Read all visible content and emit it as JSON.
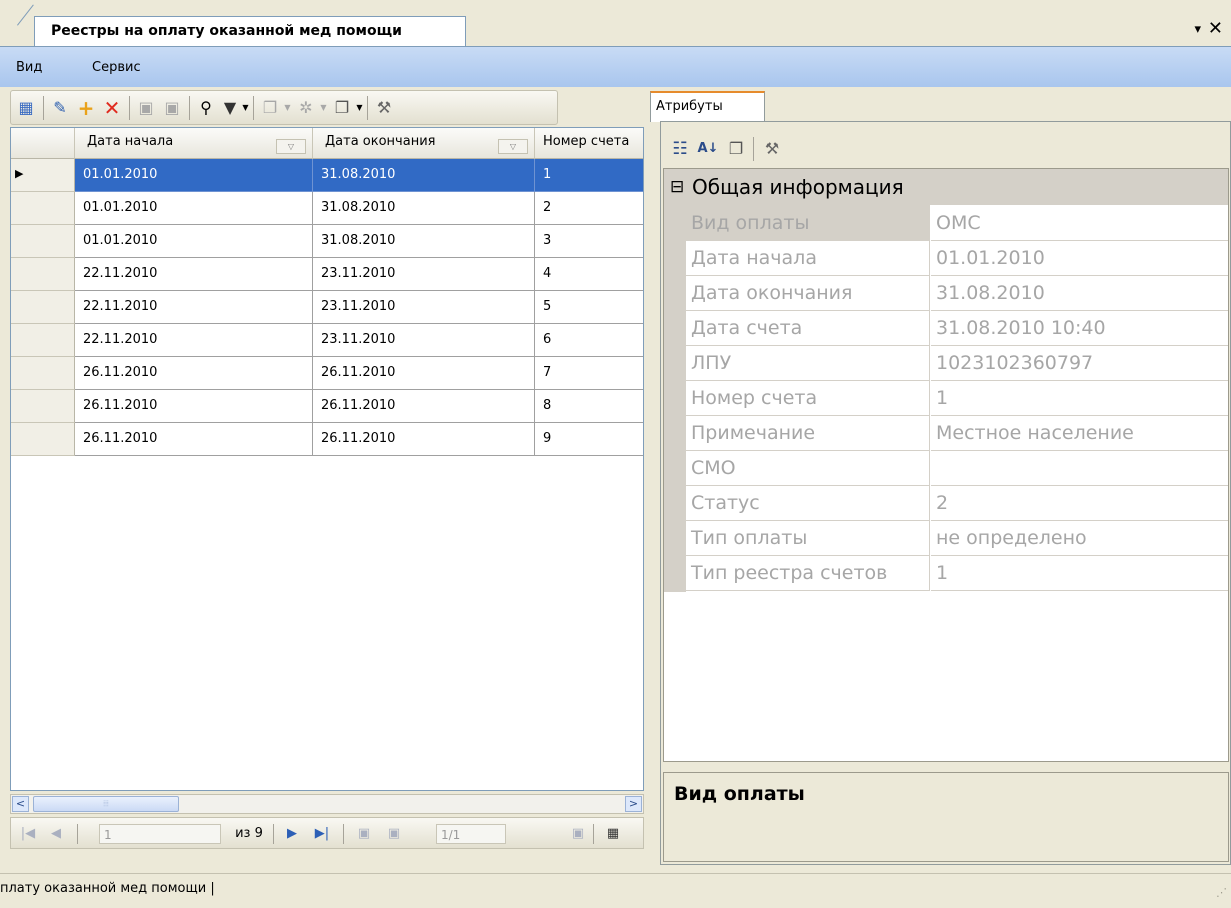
{
  "document_tab": {
    "title": "Реестры на оплату оказанной мед помощи",
    "menu_glyph": "▾",
    "close_glyph": "✕"
  },
  "menubar": {
    "items": [
      {
        "label": "Вид"
      },
      {
        "label": "Сервис"
      }
    ]
  },
  "toolbar": {
    "icons": [
      "list-view-icon",
      "edit-icon",
      "add-icon",
      "delete-icon",
      "save-icon",
      "save-all-icon",
      "find-icon",
      "filter-icon",
      "copy-icon",
      "settings-icon",
      "window-icon",
      "tools-icon"
    ]
  },
  "grid": {
    "columns": [
      {
        "label": "Дата начала",
        "sort_glyph": "▽"
      },
      {
        "label": "Дата окончания",
        "sort_glyph": "▽"
      },
      {
        "label": "Номер счета"
      }
    ],
    "current_row_glyph": "▶",
    "rows": [
      [
        "01.01.2010",
        "31.08.2010",
        "1"
      ],
      [
        "01.01.2010",
        "31.08.2010",
        "2"
      ],
      [
        "01.01.2010",
        "31.08.2010",
        "3"
      ],
      [
        "22.11.2010",
        "23.11.2010",
        "4"
      ],
      [
        "22.11.2010",
        "23.11.2010",
        "5"
      ],
      [
        "22.11.2010",
        "23.11.2010",
        "6"
      ],
      [
        "26.11.2010",
        "26.11.2010",
        "7"
      ],
      [
        "26.11.2010",
        "26.11.2010",
        "8"
      ],
      [
        "26.11.2010",
        "26.11.2010",
        "9"
      ]
    ],
    "selected_row": 0
  },
  "scrollbar": {
    "left_glyph": "<",
    "right_glyph": ">",
    "thumb_glyph": "⦙⦙⦙"
  },
  "navigator": {
    "first_glyph": "|◀",
    "prev_glyph": "◀",
    "position": "1",
    "of_label": "из 9",
    "next_glyph": "▶",
    "last_glyph": "▶|",
    "page": "1/1"
  },
  "attributes_panel": {
    "tab_label": "Атрибуты",
    "category": {
      "toggle": "⊟",
      "title": "Общая информация"
    },
    "properties": [
      {
        "name": "Вид оплаты",
        "value": "ОМС"
      },
      {
        "name": "Дата начала",
        "value": "01.01.2010"
      },
      {
        "name": "Дата окончания",
        "value": "31.08.2010"
      },
      {
        "name": "Дата счета",
        "value": "31.08.2010 10:40"
      },
      {
        "name": "ЛПУ",
        "value": "1023102360797"
      },
      {
        "name": "Номер счета",
        "value": "1"
      },
      {
        "name": "Примечание",
        "value": "Местное население"
      },
      {
        "name": "СМО",
        "value": ""
      },
      {
        "name": "Статус",
        "value": "2"
      },
      {
        "name": "Тип оплаты",
        "value": "не определено"
      },
      {
        "name": "Тип реестра счетов",
        "value": "1"
      }
    ],
    "help_title": "Вид оплаты"
  },
  "statusbar": {
    "text": "плату оказанной мед помощи |"
  }
}
